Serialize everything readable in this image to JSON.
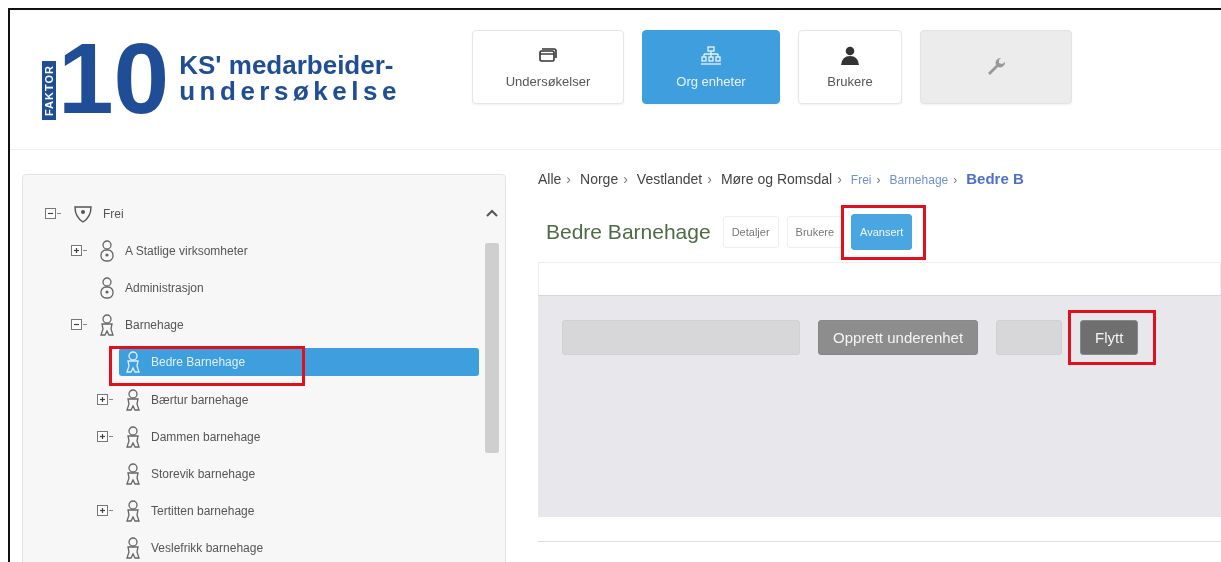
{
  "logo": {
    "mark": "10",
    "badge": "FAKTOR",
    "line1": "KS' medarbeider-",
    "line2": "undersøkelse"
  },
  "nav": [
    {
      "label": "Undersøkelser",
      "selected": false,
      "disabled": false
    },
    {
      "label": "Org enheter",
      "selected": true,
      "disabled": false
    },
    {
      "label": "Brukere",
      "selected": false,
      "disabled": false
    },
    {
      "selected": false,
      "disabled": true
    }
  ],
  "tree": [
    {
      "label": "Frei",
      "kind": "root",
      "expanded": true,
      "selected": false,
      "highlighted": false,
      "children": [
        {
          "label": "A Statlige virksomheter",
          "kind": "unit",
          "expanded": false,
          "selected": false,
          "highlighted": false
        },
        {
          "label": "Administrasjon",
          "kind": "unit",
          "selected": false,
          "highlighted": false
        },
        {
          "label": "Barnehage",
          "kind": "child",
          "expanded": true,
          "selected": false,
          "highlighted": false,
          "children": [
            {
              "label": "Bedre Barnehage",
              "kind": "child",
              "selected": true,
              "highlighted": true
            },
            {
              "label": "Bærtur barnehage",
              "kind": "child",
              "expanded": false,
              "selected": false,
              "highlighted": false
            },
            {
              "label": "Dammen barnehage",
              "kind": "child",
              "expanded": false,
              "selected": false,
              "highlighted": false
            },
            {
              "label": "Storevik barnehage",
              "kind": "child",
              "selected": false,
              "highlighted": false
            },
            {
              "label": "Tertitten barnehage",
              "kind": "child",
              "expanded": false,
              "selected": false,
              "highlighted": false
            },
            {
              "label": "Veslefrikk barnehage",
              "kind": "child",
              "selected": false,
              "highlighted": false
            }
          ]
        }
      ]
    }
  ],
  "breadcrumb": [
    {
      "label": "Alle",
      "link": false,
      "sep": "›"
    },
    {
      "label": "Norge",
      "link": false,
      "sep": "›"
    },
    {
      "label": "Vestlandet",
      "link": false,
      "sep": "›"
    },
    {
      "label": "Møre og Romsdal",
      "link": false,
      "sep": "›"
    },
    {
      "label": "Frei",
      "link": true,
      "sep": "›"
    },
    {
      "label": "Barnehage",
      "link": true,
      "sep": "›"
    },
    {
      "label": "Bedre B",
      "link": true,
      "current": true
    }
  ],
  "title": "Bedre Barnehage",
  "tabs": [
    {
      "label": "Detaljer",
      "selected": false,
      "highlighted": false
    },
    {
      "label": "Brukere",
      "selected": false,
      "highlighted": false
    },
    {
      "label": "Avansert",
      "selected": true,
      "highlighted": true
    }
  ],
  "actions": [
    {
      "disabled": true,
      "highlighted": false
    },
    {
      "label": "Opprett underenhet",
      "disabled": false,
      "highlighted": false
    },
    {
      "disabled": true,
      "highlighted": false
    },
    {
      "label": "Flytt",
      "disabled": false,
      "highlighted": true
    }
  ]
}
